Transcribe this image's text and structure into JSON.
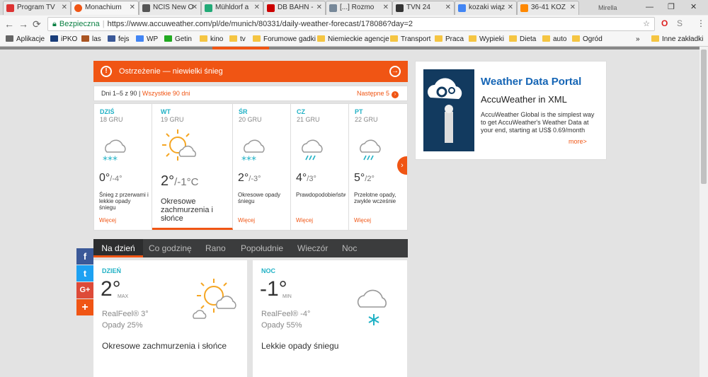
{
  "browser": {
    "tabs": [
      {
        "title": "Program TV",
        "color": "#d33"
      },
      {
        "title": "Monachium",
        "color": "#f05514"
      },
      {
        "title": "NCIS New O",
        "color": "#555"
      },
      {
        "title": "Mühldorf a",
        "color": "#2a7"
      },
      {
        "title": "DB BAHN -",
        "color": "#c00"
      },
      {
        "title": "[...] Rozmo",
        "color": "#789"
      },
      {
        "title": "TVN 24",
        "color": "#333"
      },
      {
        "title": "kozaki wiąz",
        "color": "#4285f4"
      },
      {
        "title": "36-41 KOZ",
        "color": "#f80"
      }
    ],
    "profile": "Mirella",
    "address": {
      "secure_label": "Bezpieczna",
      "url": "https://www.accuweather.com/pl/de/munich/80331/daily-weather-forecast/178086?day=2"
    },
    "bookmarks": [
      "Aplikacje",
      "iPKO",
      "las",
      "fejs",
      "WP",
      "Getin",
      "kino",
      "tv",
      "Forumowe gadki",
      "Niemieckie agencje",
      "Transport",
      "Praca",
      "Wypieki",
      "Dieta",
      "auto",
      "Ogród"
    ],
    "other_bookmarks": "Inne zakładki",
    "more": "»"
  },
  "warning": {
    "text": "Ostrzeżenie — niewielki śnieg"
  },
  "range": {
    "label": "Dni 1–5 z 90 |",
    "all_link": "Wszystkie 90 dni",
    "next": "Następne 5"
  },
  "days": [
    {
      "name": "DZIŚ",
      "date": "18 GRU",
      "hi": "0°",
      "lo": "/-4°",
      "desc": "Śnieg z przerwami i lekkie opady śniegu",
      "more": "Więcej",
      "icon": "snow-cloud"
    },
    {
      "name": "WT",
      "date": "19 GRU",
      "hi": "2°",
      "lo": "/-1°C",
      "desc": "Okresowe zachmurzenia i słońce",
      "more": "",
      "icon": "sun-cloud"
    },
    {
      "name": "ŚR",
      "date": "20 GRU",
      "hi": "2°",
      "lo": "/-3°",
      "desc": "Okresowe opady śniegu",
      "more": "Więcej",
      "icon": "snow-cloud"
    },
    {
      "name": "CZ",
      "date": "21 GRU",
      "hi": "4°",
      "lo": "/3°",
      "desc": "Prawdopodobieństwo deszczu",
      "more": "Więcej",
      "icon": "rain-cloud"
    },
    {
      "name": "PT",
      "date": "22 GRU",
      "hi": "5°",
      "lo": "/2°",
      "desc": "Przelotne opady, zwykle wcześnie",
      "more": "Więcej",
      "icon": "rain-cloud"
    }
  ],
  "tabs": [
    "Na dzień",
    "Co godzinę",
    "Rano",
    "Popołudnie",
    "Wieczór",
    "Noc"
  ],
  "panels": {
    "day": {
      "label": "DZIEŃ",
      "temp": "2°",
      "unit": "MAX",
      "realfeel": "RealFeel® 3°",
      "precip": "Opady 25%",
      "desc": "Okresowe zachmurzenia i słońce"
    },
    "night": {
      "label": "NOC",
      "temp": "-1°",
      "unit": "MIN",
      "realfeel": "RealFeel® -4°",
      "precip": "Opady 55%",
      "desc": "Lekkie opady śniegu"
    }
  },
  "ad": {
    "title": "Weather Data Portal",
    "subtitle": "AccuWeather in XML",
    "text": "AccuWeather Global is the simplest way to get AccuWeather's Weather Data at your end, starting at US$ 0.69/month",
    "more": "more>"
  },
  "colors": {
    "accent": "#f05514",
    "teal": "#1fb1c5",
    "dark": "#3b3c3d"
  }
}
